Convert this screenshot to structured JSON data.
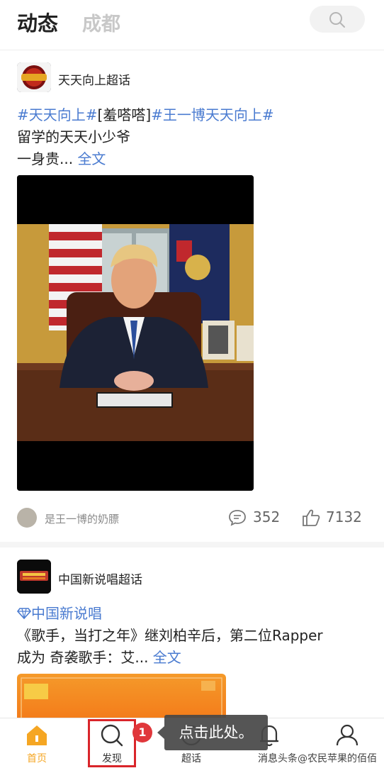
{
  "header": {
    "tab_active": "动态",
    "tab_inactive": "成都"
  },
  "post1": {
    "group_name": "天天向上超话",
    "hashtag1": "#天天向上#",
    "emoji_text": "[羞嗒嗒]",
    "hashtag2": "#王一博天天向上#",
    "line2": "留学的天天小少爷",
    "line3_prefix": "一身贵...",
    "full_text_link": "全文",
    "author": "是王一博的奶膘",
    "comments": "352",
    "likes": "7132"
  },
  "post2": {
    "group_name": "中国新说唱超话",
    "topic": "中国新说唱",
    "line1": "《歌手，当打之年》继刘柏辛后，第二位Rapper",
    "line2_prefix": "成为 奇袭歌手：艾...",
    "full_text_link": "全文"
  },
  "tabbar": {
    "home": "首页",
    "discover": "发现",
    "super_topic": "超话",
    "messages": "消息",
    "profile": ""
  },
  "overlay": {
    "badge_number": "1",
    "tooltip": "点击此处。",
    "watermark": "头条@农民苹果的佰佰"
  },
  "colors": {
    "accent_orange": "#f5a623",
    "link_blue": "#4a7bd0",
    "highlight_red": "#d9252a"
  }
}
